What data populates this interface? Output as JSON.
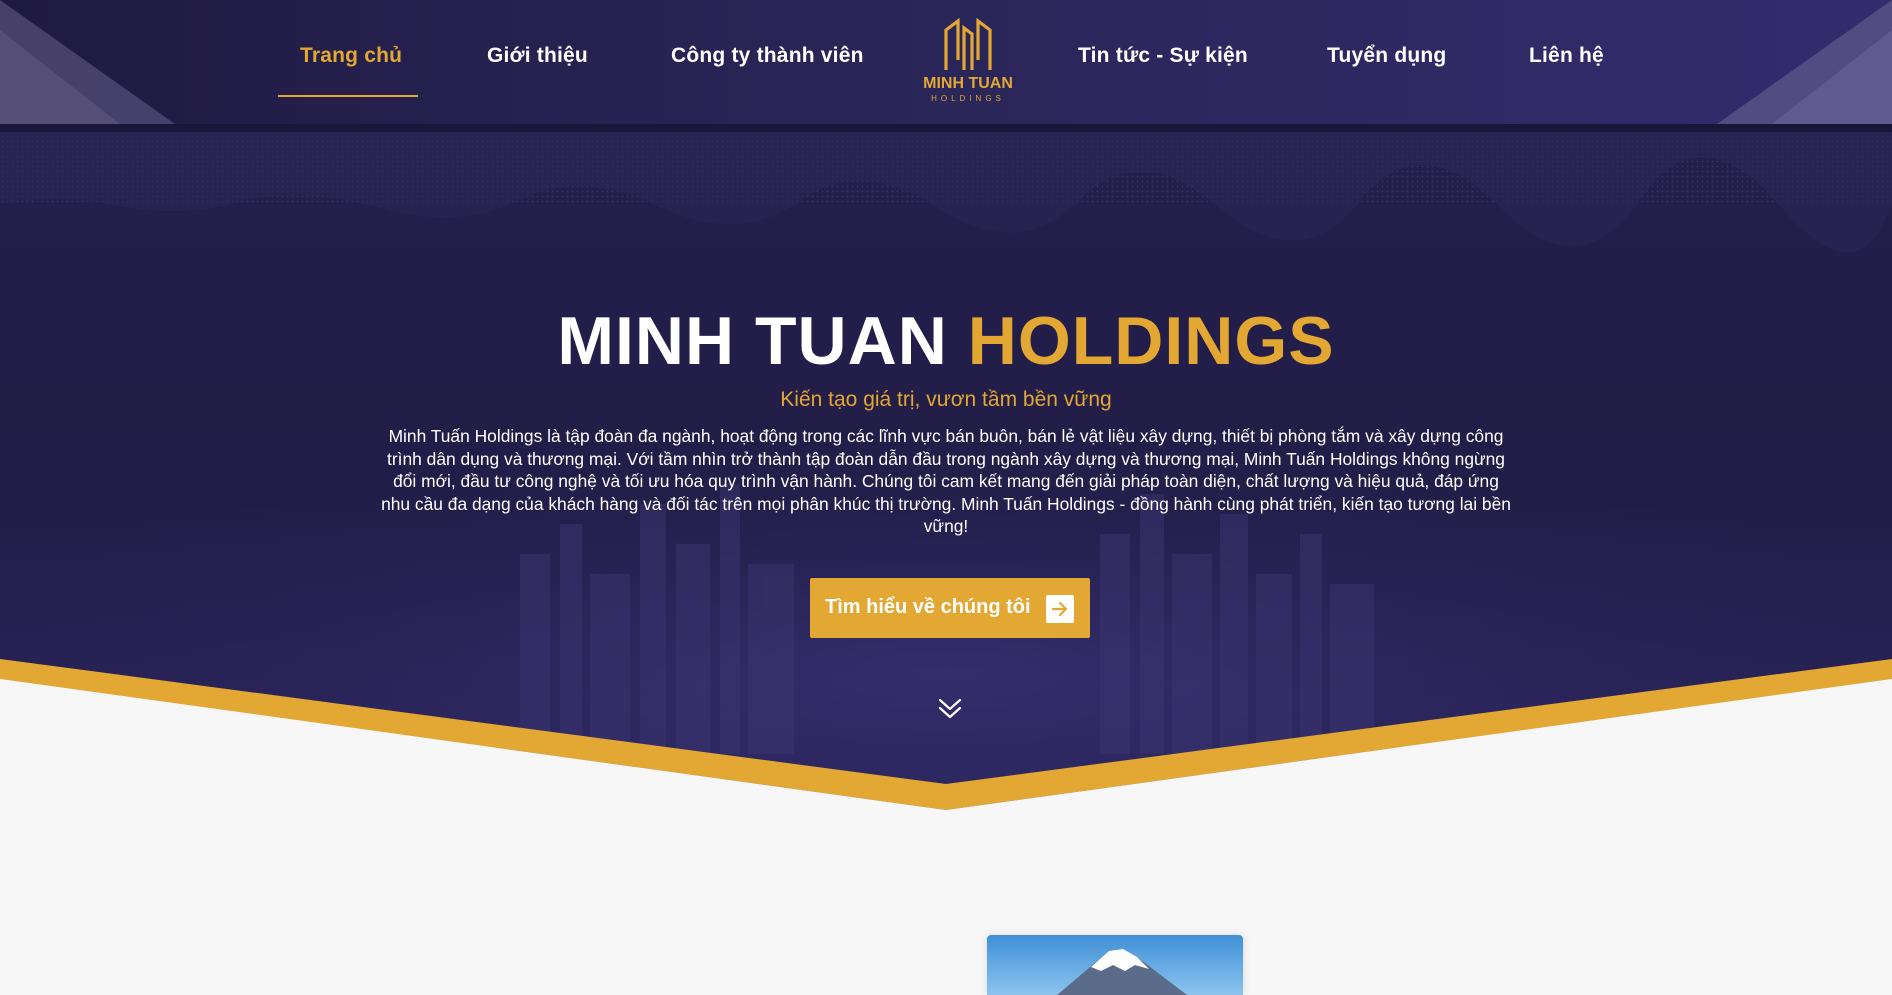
{
  "nav": {
    "left_items": [
      {
        "label": "Trang chủ",
        "active": true
      },
      {
        "label": "Giới thiệu",
        "active": false
      },
      {
        "label": "Công ty thành viên",
        "active": false
      }
    ],
    "right_items": [
      {
        "label": "Tin tức - Sự kiện",
        "active": false
      },
      {
        "label": "Tuyển dụng",
        "active": false
      },
      {
        "label": "Liên hệ",
        "active": false
      }
    ]
  },
  "logo": {
    "name": "MINH TUAN",
    "sub": "HOLDINGS"
  },
  "hero": {
    "title_main": "MINH TUAN",
    "title_accent": "HOLDINGS",
    "subtitle": "Kiến tạo giá trị, vươn tầm bền vững",
    "description": "Minh Tuấn Holdings là tập đoàn đa ngành, hoạt động trong các lĩnh vực bán buôn, bán lẻ vật liệu xây dựng, thiết bị phòng tắm và xây dựng công trình dân dụng và thương mại. Với tầm nhìn trở thành tập đoàn dẫn đầu trong ngành xây dựng và thương mại, Minh Tuấn Holdings không ngừng đổi mới, đầu tư công nghệ và tối ưu hóa quy trình vận hành. Chúng tôi cam kết mang đến giải pháp toàn diện, chất lượng và hiệu quả, đáp ứng nhu cầu đa dạng của khách hàng và đối tác trên mọi phân khúc thị trường. Minh Tuấn Holdings - đồng hành cùng phát triển, kiến tạo tương lai bền vững!",
    "cta_label": "Tìm hiểu về chúng tôi",
    "cta_icon": "arrow-right-icon",
    "scroll_icon": "double-chevron-down-icon"
  },
  "colors": {
    "primary_dark": "#221d48",
    "accent_gold": "#e3a733",
    "white": "#ffffff",
    "page_bg": "#f7f7f8"
  }
}
